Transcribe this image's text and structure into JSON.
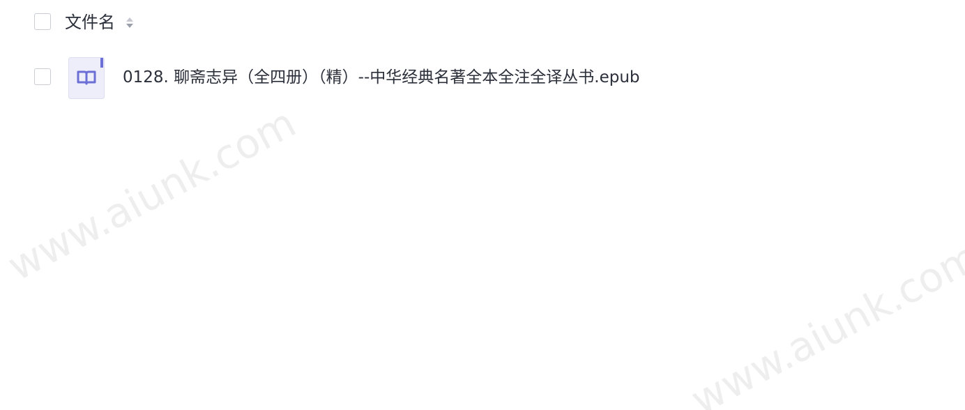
{
  "table": {
    "header": {
      "column_title": "文件名",
      "sort_icon": "sort-icon"
    },
    "rows": [
      {
        "name": "0128. 聊斋志异（全四册）（精）--中华经典名著全本全注全译丛书.epub",
        "icon": "epub-book-icon",
        "selected": false
      }
    ]
  },
  "watermarks": [
    "www.aiunk.com",
    "www.aiunk.com"
  ],
  "colors": {
    "text": "#2b2f3a",
    "checkbox_border": "#c9ccd4",
    "file_icon_bg": "#eeeefb",
    "file_icon_accent": "#6b6fd6"
  }
}
